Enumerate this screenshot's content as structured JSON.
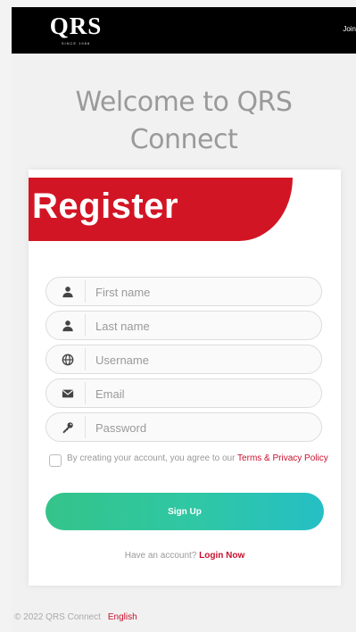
{
  "header": {
    "logo_text": "QRS",
    "logo_sub": "SINCE 1988",
    "join_label": "Join"
  },
  "welcome": {
    "line1": "Welcome to QRS",
    "line2": "Connect"
  },
  "register": {
    "title": "Register"
  },
  "fields": [
    {
      "icon": "user-icon",
      "placeholder": "First name"
    },
    {
      "icon": "user-icon",
      "placeholder": "Last name"
    },
    {
      "icon": "globe-icon",
      "placeholder": "Username"
    },
    {
      "icon": "envelope-icon",
      "placeholder": "Email"
    },
    {
      "icon": "key-icon",
      "placeholder": "Password"
    }
  ],
  "terms": {
    "prefix": "By creating your account, you agree to our ",
    "link": "Terms & Privacy Policy"
  },
  "signup_label": "Sign Up",
  "have_account": {
    "prefix": "Have an account? ",
    "link": "Login Now"
  },
  "footer": {
    "copyright": "© 2022 QRS Connect",
    "language": "English"
  },
  "colors": {
    "brand_red": "#d21524",
    "link_red": "#c8102e",
    "button_green": "#34c48a",
    "button_teal": "#25bfc5"
  }
}
